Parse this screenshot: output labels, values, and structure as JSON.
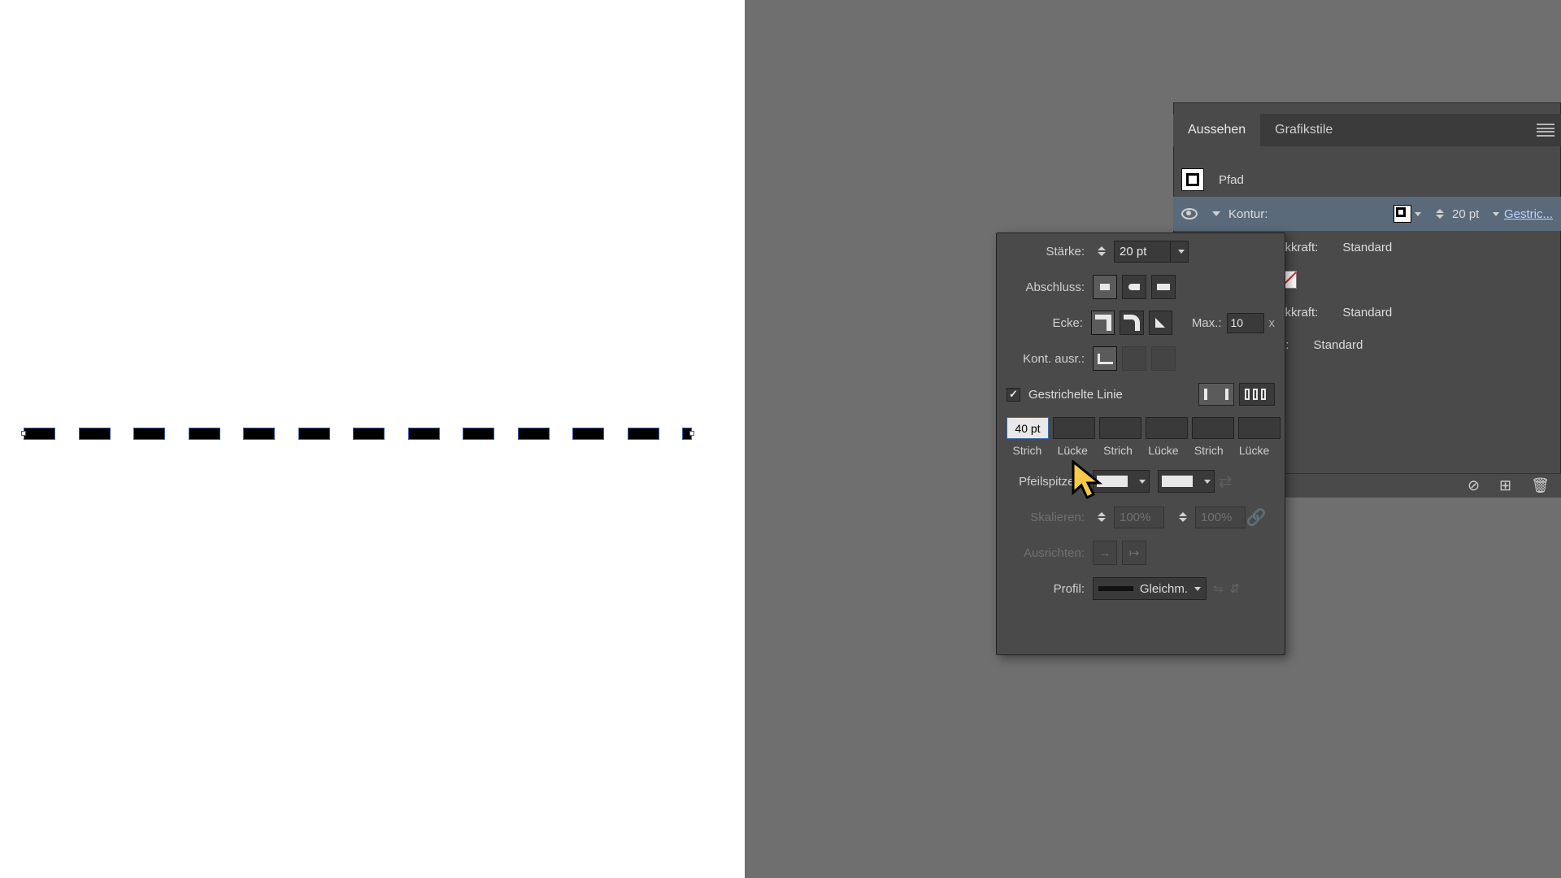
{
  "appearance": {
    "tabs": {
      "aussehen": "Aussehen",
      "grafikstile": "Grafikstile"
    },
    "object_type": "Pfad",
    "stroke_row": {
      "label": "Kontur:",
      "weight": "20 pt",
      "dash_link": "Gestric..."
    },
    "opacity_rows": {
      "label1": "ckkraft:",
      "value1": "Standard",
      "label2": "ckkraft:",
      "value2": "Standard",
      "label3": "ft:",
      "value3": "Standard"
    }
  },
  "stroke": {
    "labels": {
      "staerke": "Stärke:",
      "abschluss": "Abschluss:",
      "ecke": "Ecke:",
      "kont_ausr": "Kont. ausr.:",
      "gestrichelte": "Gestrichelte Linie",
      "pfeilspitzen": "Pfeilspitzen:",
      "skalieren": "Skalieren:",
      "ausrichten": "Ausrichten:",
      "profil": "Profil:",
      "max": "Max.:"
    },
    "weight": "20 pt",
    "miter_limit": "10",
    "dashed_checked": true,
    "dash_values": [
      "40 pt",
      "",
      "",
      "",
      "",
      ""
    ],
    "dash_headers": [
      "Strich",
      "Lücke",
      "Strich",
      "Lücke",
      "Strich",
      "Lücke"
    ],
    "scale1": "100%",
    "scale2": "100%",
    "profile_text": "Gleichm."
  }
}
